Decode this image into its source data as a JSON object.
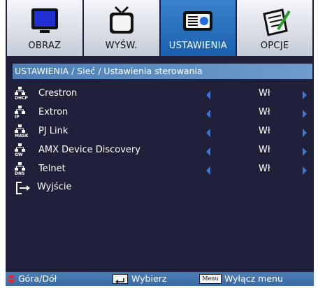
{
  "tabs": [
    {
      "label": "OBRAZ",
      "icon": "monitor-icon"
    },
    {
      "label": "WYŚW.",
      "icon": "tv-icon"
    },
    {
      "label": "USTAWIENIA",
      "icon": "projector-icon"
    },
    {
      "label": "OPCJE",
      "icon": "notepad-icon"
    }
  ],
  "active_tab": "USTAWIENIA",
  "breadcrumb": "USTAWIENIA / Sieć / Ustawienia sterowania",
  "rows": [
    {
      "label": "Crestron",
      "value": "Wł",
      "icon_label": "DHCP"
    },
    {
      "label": "Extron",
      "value": "Wł",
      "icon_label": "IP"
    },
    {
      "label": "PJ Link",
      "value": "Wł",
      "icon_label": "MASK"
    },
    {
      "label": "AMX Device Discovery",
      "value": "Wł",
      "icon_label": "GW"
    },
    {
      "label": "Telnet",
      "value": "Wł",
      "icon_label": "DNS"
    }
  ],
  "exit_label": "Wyjście",
  "footer": {
    "updown": "Góra/Dół",
    "select": "Wybierz",
    "menu_key": "Menu",
    "exit": "Wyłącz menu"
  },
  "colors": {
    "background": "#20203a",
    "accent": "#1a5fae",
    "arrow": "#3b78d6",
    "updown": "#e0282e"
  }
}
